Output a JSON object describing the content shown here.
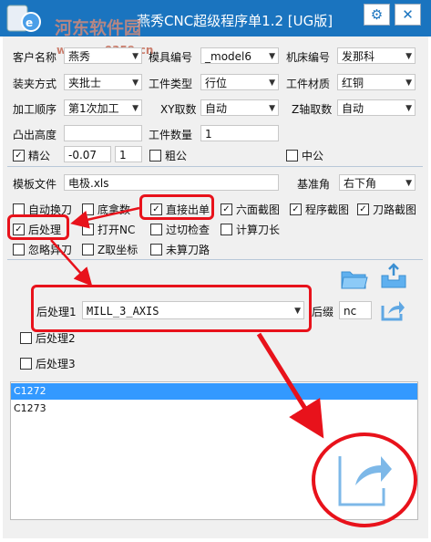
{
  "window": {
    "title": "燕秀CNC超级程序单1.2 [UG版]",
    "settings_glyph": "⚙",
    "close_glyph": "✕",
    "watermark_text": "河东软件园",
    "watermark_url": "www.pc0359.cn"
  },
  "form": {
    "customer_label": "客户名称",
    "customer_value": "燕秀",
    "mold_no_label": "模具编号",
    "mold_no_value": "_model6",
    "machine_no_label": "机床编号",
    "machine_no_value": "发那科",
    "clamp_label": "装夹方式",
    "clamp_value": "夹批士",
    "workpiece_type_label": "工件类型",
    "workpiece_type_value": "行位",
    "material_label": "工件材质",
    "material_value": "红铜",
    "order_label": "加工顺序",
    "order_value": "第1次加工",
    "xy_label": "XY取数",
    "xy_value": "自动",
    "z_label": "Z轴取数",
    "z_value": "自动",
    "height_label": "凸出高度",
    "qty_label": "工件数量",
    "qty_value": "1",
    "finish_label": "精公",
    "finish_value": "-0.07",
    "finish_count": "1",
    "rough_label": "粗公",
    "mid_label": "中公"
  },
  "template": {
    "label": "模板文件",
    "value": "电极.xls",
    "datum_label": "基准角",
    "datum_value": "右下角"
  },
  "options": {
    "auto_tool_change": "自动换刀",
    "bottom_count": "底拿数",
    "direct_output": "直接出单",
    "six_view": "六面截图",
    "program_shot": "程序截图",
    "toolpath_shot": "刀路截图",
    "post_process": "后处理",
    "open_nc": "打开NC",
    "gouge_check": "过切检查",
    "calc_tool_length": "计算刀长",
    "ignore_tool": "忽略异刀",
    "z_coord": "Z取坐标",
    "no_calc_path": "未算刀路"
  },
  "postproc": {
    "pp1_label": "后处理1",
    "pp1_value": "MILL_3_AXIS",
    "suffix_label": "后缀",
    "suffix_value": "nc",
    "pp2_label": "后处理2",
    "pp3_label": "后处理3"
  },
  "list": {
    "items": [
      "C1272",
      "C1273"
    ]
  }
}
